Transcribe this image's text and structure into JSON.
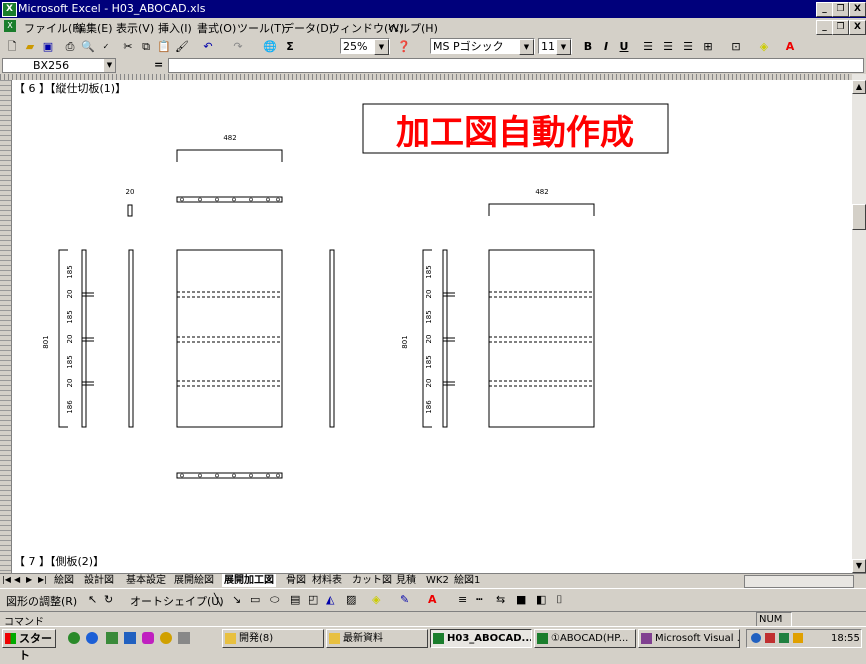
{
  "window": {
    "title": "Microsoft Excel - H03_ABOCAD.xls",
    "app_icon": "excel-icon",
    "controls": [
      "_",
      "❐",
      "X"
    ],
    "doc_controls": [
      "_",
      "❐",
      "X"
    ]
  },
  "menu": [
    "ファイル(F)",
    "編集(E)",
    "表示(V)",
    "挿入(I)",
    "書式(O)",
    "ツール(T)",
    "データ(D)",
    "ウィンドウ(W)",
    "ヘルプ(H)"
  ],
  "toolbar": {
    "zoom": "25%",
    "font_name": "MS Pゴシック",
    "font_size": "11",
    "bold": "B",
    "italic": "I",
    "underline": "U",
    "sum": "Σ"
  },
  "formula_bar": {
    "name_box": "BX256",
    "equals": "=",
    "value": ""
  },
  "sheet": {
    "section6_heading": "【 6 】【縦仕切板(1)】",
    "section7_heading": "【 7 】【側板(2)】",
    "banner": "加工図自動作成",
    "dims": {
      "top_width_left": "482",
      "top_width_right": "482",
      "thickness": "20",
      "height_left": "801",
      "height_right": "801",
      "seg_left": [
        "185",
        "20",
        "185",
        "20",
        "185",
        "20",
        "186"
      ],
      "seg_right": [
        "185",
        "20",
        "185",
        "20",
        "185",
        "20",
        "186"
      ]
    },
    "colors": {
      "banner_text": "#ff0000",
      "banner_border": "#000000"
    }
  },
  "sheet_tabs": [
    "絵図",
    "設計図",
    "基本設定",
    "展開絵図",
    "展開加工図",
    "骨図",
    "材料表",
    "カット図",
    "見積",
    "WK2",
    "絵図1"
  ],
  "active_tab": "展開加工図",
  "draw_toolbar": {
    "draw_menu": "図形の調整(R)",
    "autoshape_menu": "オートシェイプ(U)"
  },
  "status": {
    "mode": "コマンド",
    "num": "NUM"
  },
  "taskbar": {
    "start": "スタート",
    "buttons": [
      "開発(8)",
      "最新資料",
      "H03_ABOCAD...",
      "①ABOCAD(HP...",
      "Microsoft Visual ..."
    ],
    "active_index": 2,
    "clock": "18:55"
  }
}
